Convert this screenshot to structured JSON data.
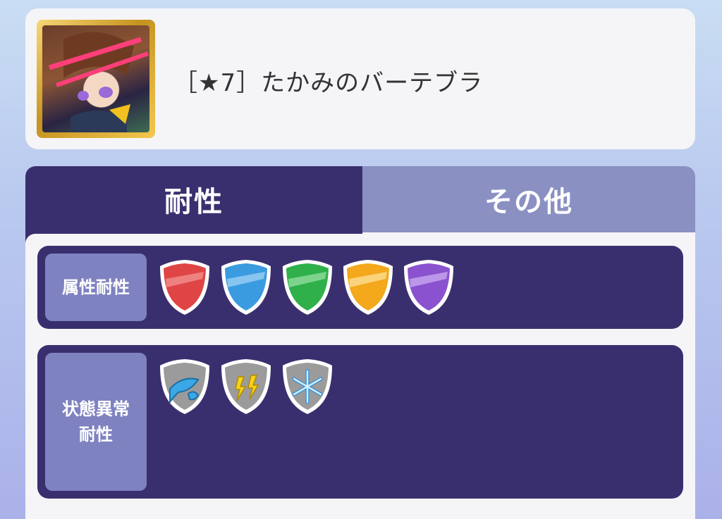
{
  "header": {
    "character_name": "［★7］たかみのバーテブラ"
  },
  "tabs": [
    {
      "label": "耐性",
      "active": true
    },
    {
      "label": "その他",
      "active": false
    }
  ],
  "attribute_resistance": {
    "label": "属性耐性",
    "shields": [
      {
        "icon": "red-shield-icon",
        "color": "#e04545"
      },
      {
        "icon": "blue-shield-icon",
        "color": "#3a9be0"
      },
      {
        "icon": "green-shield-icon",
        "color": "#2fb04a"
      },
      {
        "icon": "yellow-shield-icon",
        "color": "#f4a81c"
      },
      {
        "icon": "purple-shield-icon",
        "color": "#8b52cf"
      }
    ]
  },
  "status_resistance": {
    "label": "状態異常\n耐性",
    "shields": [
      {
        "icon": "water-drop-shield-icon"
      },
      {
        "icon": "lightning-shield-icon"
      },
      {
        "icon": "snowflake-shield-icon"
      }
    ]
  }
}
